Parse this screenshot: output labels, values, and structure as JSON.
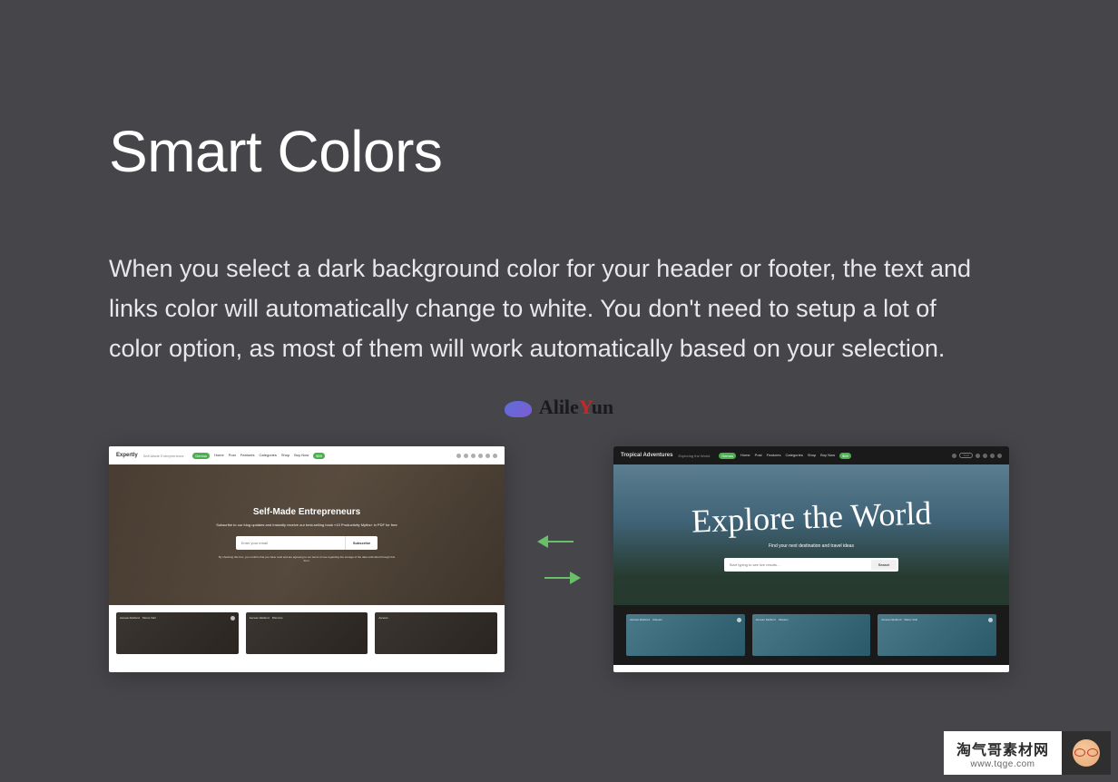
{
  "heading": "Smart Colors",
  "description": "When you select a dark background color for your header or footer, the text and links color will automatically change to white. You don't need to setup a lot of color option, as most of them will work automatically based on your selection.",
  "watermark": {
    "text_pre": "Alile",
    "text_y": "Y",
    "text_post": "un"
  },
  "demo_left": {
    "logo": "Expertly",
    "tagline": "Self-Made Entrepreneurs",
    "nav": {
      "demos": "Demos",
      "home": "Home",
      "post": "Post",
      "features": "Features",
      "categories": "Categories",
      "shop": "Shop",
      "buy": "Buy Now",
      "buy_badge": "$59"
    },
    "hero_title": "Self-Made Entrepreneurs",
    "hero_sub": "Subscribe to our blog updates and instantly receive our best-selling book «10 Productivity Myths» in PDF for free",
    "email_placeholder": "Enter your email",
    "subscribe": "Subscribe",
    "terms": "By checking this box, you confirm that you have read and are agreeing to our terms of use regarding the storage of the data submitted through this form.",
    "cards": [
      {
        "tags": [
          "Aenean Eleifend",
          "Metus Velit"
        ]
      },
      {
        "tags": [
          "Aenean Eleifend",
          "Rhoncus"
        ]
      },
      {
        "tags": [
          "Aenean"
        ]
      }
    ]
  },
  "demo_right": {
    "logo": "Tropical Adventures",
    "tagline": "Exploring the World",
    "nav": {
      "demos": "Demos",
      "home": "Home",
      "post": "Post",
      "features": "Features",
      "categories": "Categories",
      "shop": "Shop",
      "buy": "Buy Now",
      "buy_badge": "$59",
      "count": "7125"
    },
    "hero_title": "Explore the World",
    "hero_sub": "Find your next destination and travel ideas",
    "search_placeholder": "Start typing to see live results…",
    "search_btn": "Search",
    "cards": [
      {
        "tags": [
          "Aenean Eleifend",
          "Aliquam"
        ]
      },
      {
        "tags": [
          "Aenean Eleifend",
          "Aliquam"
        ]
      },
      {
        "tags": [
          "Aenean Eleifend",
          "Metus Velit"
        ]
      }
    ]
  },
  "corner": {
    "cn": "淘气哥素材网",
    "url": "www.tqge.com"
  }
}
